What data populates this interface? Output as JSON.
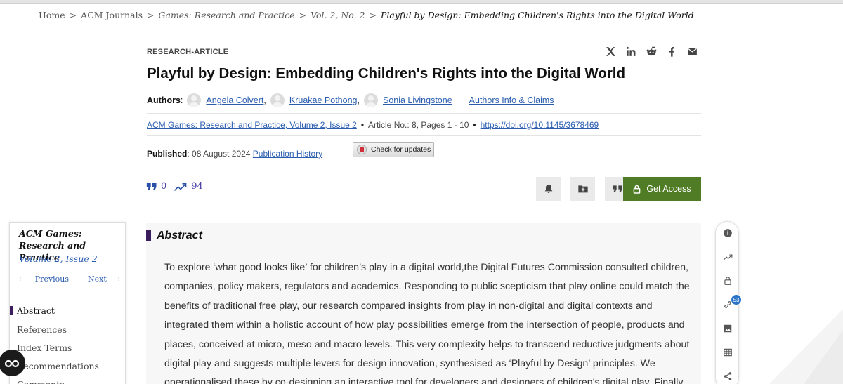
{
  "breadcrumb": {
    "items": [
      "Home",
      "ACM Journals",
      "Games: Research and Practice",
      "Vol. 2, No. 2",
      "Playful by Design: Embedding Children's Rights into the Digital World"
    ],
    "separator": ">"
  },
  "article": {
    "type": "RESEARCH-ARTICLE",
    "title": "Playful by Design: Embedding Children's Rights into the Digital World",
    "authors_label": "Authors",
    "authors": [
      "Angela Colvert",
      "Kruakae Pothong",
      "Sonia Livingstone"
    ],
    "authors_info_link": "Authors Info & Claims",
    "citation": {
      "venue": "ACM Games: Research and Practice, Volume 2, Issue 2",
      "article_info": "Article No.: 8, Pages 1 - 10",
      "doi": "https://doi.org/10.1145/3678469"
    },
    "published_label": "Published",
    "published_date": "08 August 2024",
    "publication_history_link": "Publication History",
    "check_updates_label": "Check for updates"
  },
  "metrics": {
    "citations": "0",
    "downloads": "94"
  },
  "actions": {
    "get_access_label": "Get Access"
  },
  "share_icons": [
    "x-icon",
    "linkedin-icon",
    "reddit-icon",
    "facebook-icon",
    "email-icon"
  ],
  "toc": {
    "journal_name": "ACM Games: Research and Practice",
    "volume_issue": "Volume 2, Issue 2",
    "previous_label": "Previous",
    "next_label": "Next",
    "items": [
      "Abstract",
      "References",
      "Index Terms",
      "Recommendations",
      "Comments"
    ]
  },
  "abstract": {
    "heading": "Abstract",
    "text": "To explore ‘what good looks like’ for children’s play in a digital world,the Digital Futures Commission consulted children, companies, policy makers, regulators and academics. Responding to public scepticism that play online could match the benefits of traditional free play, our research compared insights from play in non-digital and digital contexts and integrated them within a holistic account of how play possibilities emerge from the intersection of people, products and places, conceived at micro, meso and macro levels. This very complexity helps to transcend reductive judgments about digital play and suggests multiple levers for design innovation, synthesised as ‘Playful by Design’ principles. We operationalised these by co-designing an interactive tool for developers and designers of children’s digital play. Finally"
  },
  "side_rail": {
    "badge_count": "53"
  },
  "colors": {
    "accent_purple": "#3b1d5e",
    "link_blue": "#2a5db0",
    "access_green": "#4f7c24"
  }
}
